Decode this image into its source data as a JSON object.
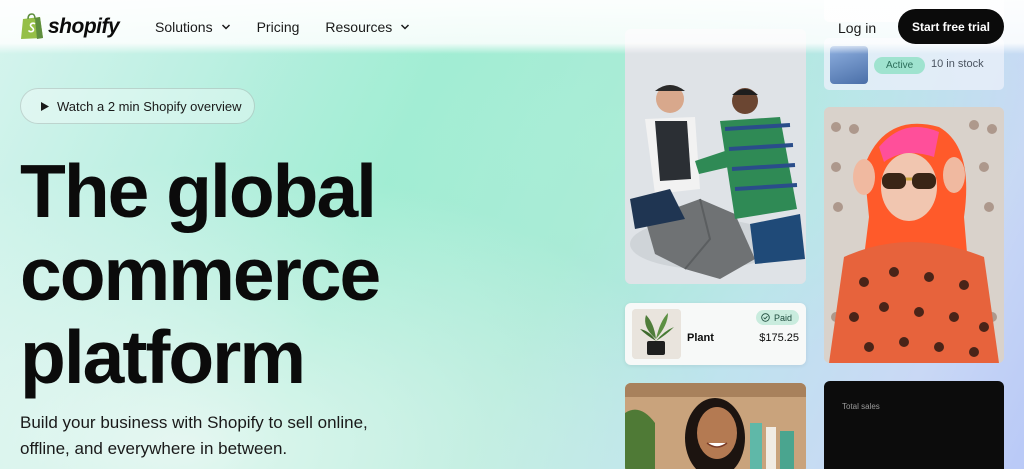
{
  "nav": {
    "brand": "shopify",
    "links": [
      {
        "label": "Solutions",
        "has_dropdown": true
      },
      {
        "label": "Pricing",
        "has_dropdown": false
      },
      {
        "label": "Resources",
        "has_dropdown": true
      }
    ],
    "login": "Log in",
    "cta": "Start free trial"
  },
  "hero": {
    "overview_link": "Watch a 2 min Shopify overview",
    "headline_lines": [
      "The global",
      "commerce",
      "platform"
    ],
    "subtitle": "Build your business with Shopify to sell online, offline, and everywhere in between."
  },
  "cards": {
    "inventory": {
      "status": "Active",
      "stock": "10 in stock"
    },
    "order": {
      "badge": "Paid",
      "product": "Plant",
      "price": "$175.25"
    },
    "sales": {
      "label": "Total sales"
    }
  },
  "colors": {
    "brand_green": "#95bf47",
    "button_dark": "#0b0b0b",
    "active_badge": "#9fe3cf",
    "paid_badge": "#c9ecde"
  }
}
